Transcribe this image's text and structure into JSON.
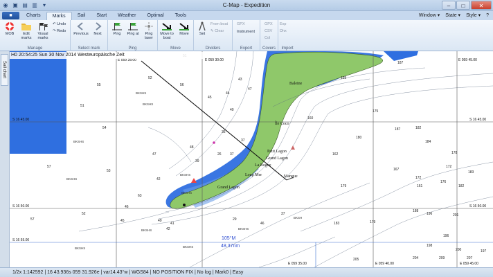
{
  "window": {
    "title": "C-Map - Expedition"
  },
  "menu": {
    "file_label": "■",
    "tabs": [
      "Charts",
      "Marks",
      "Sail",
      "Start",
      "Weather",
      "Optimal",
      "Tools"
    ],
    "active_tab": "Marks",
    "right": [
      "Window ▾",
      "State ▾",
      "Style ▾"
    ]
  },
  "ribbon": {
    "manage": {
      "label": "Manage",
      "mob": "MOB",
      "edit": "Edit marks",
      "visual": "Visual marks",
      "undo": "Undo",
      "redo": "Redo"
    },
    "select_mark": {
      "label": "Select mark",
      "previous": "Previous",
      "next": "Next"
    },
    "ping": {
      "label": "Ping",
      "ping": "Ping",
      "ping_at": "Ping at",
      "ping_laser": "Ping laser"
    },
    "move": {
      "label": "Move",
      "move_to_boat": "Move to boat",
      "move": "Move"
    },
    "dividers": {
      "label": "Dividers",
      "set": "Set",
      "from_boat": "From boat",
      "clear": "Clear"
    },
    "export": {
      "label": "Export",
      "gpx": "GPX",
      "instrument": "Instrument"
    },
    "covers": {
      "label": "Covers",
      "gpx": "GPX",
      "csv": "CSV",
      "col": "Col"
    },
    "import": {
      "label": "Import",
      "exp": "Exp",
      "dhx": "Dhx"
    }
  },
  "sidebar": {
    "tab_label": "Sail chart"
  },
  "chart": {
    "info": "H0 20:54:25 Sun 30 Nov 2014 Westeuropäische Zeit",
    "grid_labels": {
      "top_w": "E 059 28.00",
      "top_m": "E 059 30.00",
      "top_e": "E 059 45.00",
      "bot_m": "E 059 35.00",
      "bot_e": "E 059 40.00",
      "bot_r": "E 059 45.00",
      "lat1_l": "S 16 45.00",
      "lat1_r": "S 16 45.00",
      "lat2_l": "S 16 50.00",
      "lat2_r": "S 16 50.00",
      "lat3_l": "S 16 55.00"
    },
    "places": [
      "Baleine",
      "Île Coco",
      "Petit Lagon",
      "Grand Lagon",
      "La Rogue",
      "Loup Mer",
      "Grand Lagon",
      "Mangue"
    ],
    "bearing": "105°M",
    "distance": "48.37nm",
    "depths": [
      "57",
      "57",
      "51",
      "52",
      "56",
      "49",
      "41",
      "42",
      "63",
      "46",
      "45",
      "187",
      "165",
      "160",
      "175",
      "180",
      "182",
      "187",
      "162",
      "167",
      "172",
      "179",
      "188",
      "196",
      "201",
      "179",
      "183",
      "198",
      "196",
      "200",
      "197",
      "178",
      "161",
      "176",
      "182",
      "172",
      "183",
      "204",
      "209",
      "207",
      "205",
      "184",
      "35",
      "26",
      "37",
      "37",
      "45",
      "44",
      "47",
      "43",
      "40",
      "55",
      "54",
      "51",
      "53",
      "52",
      "47",
      "42",
      "39",
      "48",
      "46",
      "37",
      "29"
    ],
    "bottom_codes": [
      "BKSHS",
      "BKSHS",
      "BKSHS",
      "BKSHS",
      "BKSHS",
      "BKSHS",
      "BKSHS",
      "BKSHS",
      "BKSH",
      "BKSHS",
      "BKSHS"
    ]
  },
  "status": {
    "text": "1/2x 1:142592 | 16 43.936s 059 31.926e | var14.43°w | WGS84 | NO POSITION FIX | No log | Mark0 | Easy"
  },
  "colors": {
    "land": "#8fc86a",
    "shallow": "#2f6fe0",
    "deep": "#ffffff",
    "ribbon": "#dbe7f4"
  }
}
